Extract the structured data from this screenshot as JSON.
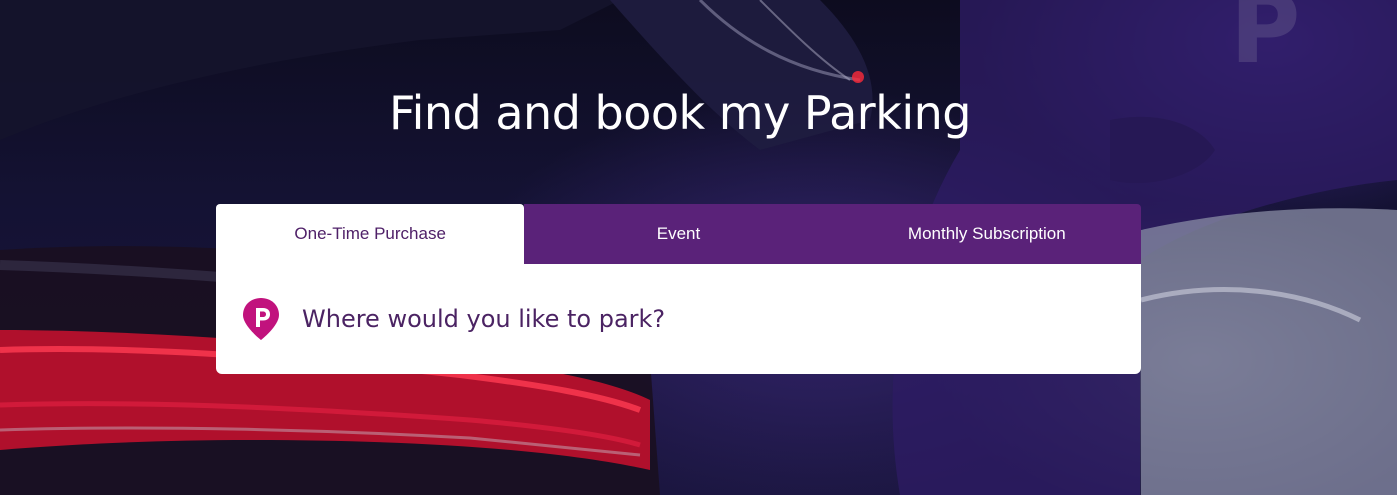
{
  "hero": {
    "title": "Find and book my Parking"
  },
  "tabs": [
    {
      "label": "One-Time Purchase",
      "active": true
    },
    {
      "label": "Event",
      "active": false
    },
    {
      "label": "Monthly Subscription",
      "active": false
    }
  ],
  "search": {
    "placeholder": "Where would you like to park?",
    "value": ""
  },
  "icons": {
    "pin": "parking-pin-icon"
  },
  "colors": {
    "tab_bg": "#5a2279",
    "active_tab_text": "#4f2068",
    "pin": "#c1127d",
    "search_text": "#4b2363"
  }
}
